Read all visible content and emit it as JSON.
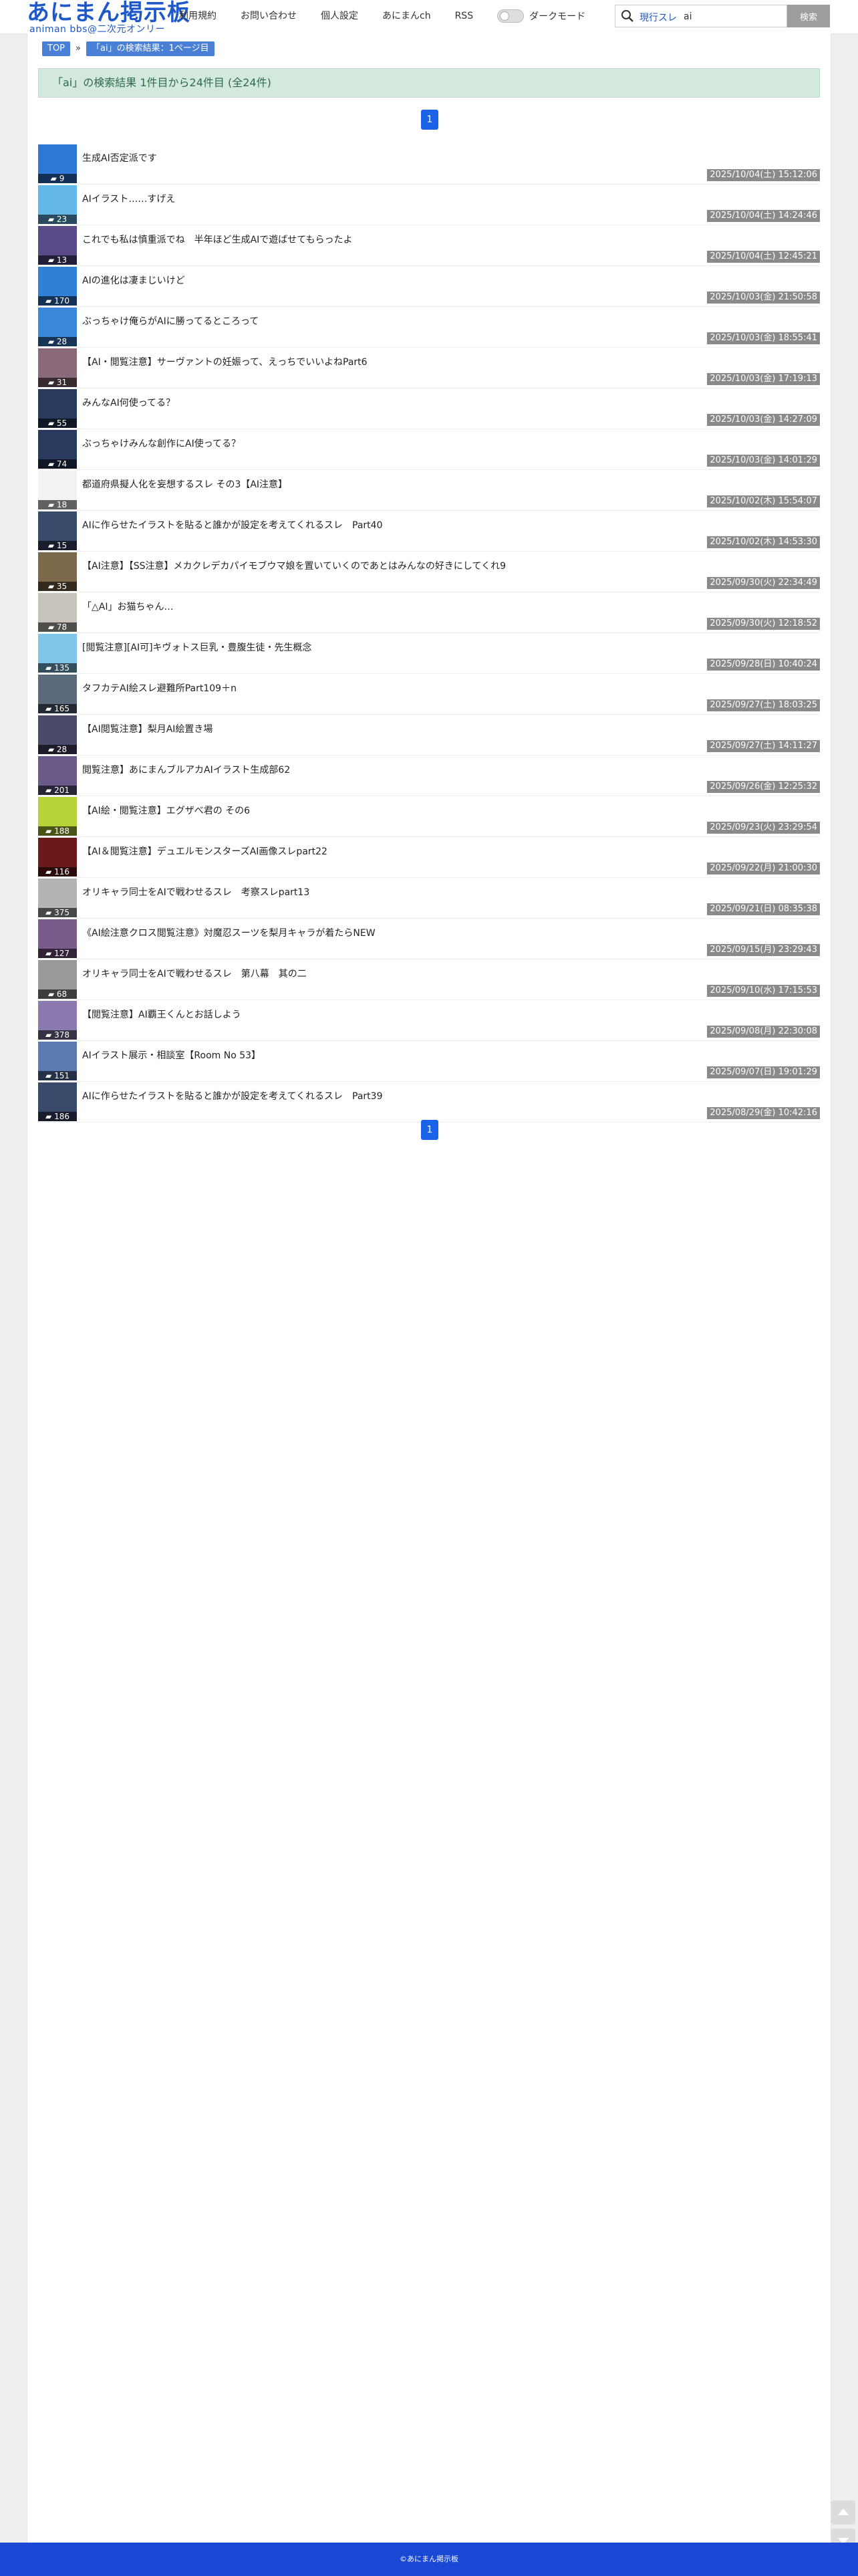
{
  "header": {
    "logo_main": "あにまん掲示板",
    "logo_sub": "animan bbs@二次元オンリー",
    "nav": [
      "利用規約",
      "お問い合わせ",
      "個人設定",
      "あにまんch",
      "RSS"
    ],
    "dark_mode_label": "ダークモード",
    "search_scope": "現行スレ",
    "search_value": "ai",
    "search_button": "検索"
  },
  "breadcrumb": [
    "TOP",
    "「ai」の検索結果：1ページ目"
  ],
  "result_banner": "「ai」の検索結果 1件目から24件目 (全24件)",
  "pager": [
    "1"
  ],
  "threads": [
    {
      "title": "生成AI否定派です",
      "count": "9",
      "date": "2025/10/04(土) 15:12:06",
      "color": "#2f78d6"
    },
    {
      "title": "AIイラスト……すげえ",
      "count": "23",
      "date": "2025/10/04(土) 14:24:46",
      "color": "#64b8ea"
    },
    {
      "title": "これでも私は慎重派でね　半年ほど生成AIで遊ばせてもらったよ",
      "count": "13",
      "date": "2025/10/04(土) 12:45:21",
      "color": "#5a4a8a"
    },
    {
      "title": "AIの進化は凄まじいけど",
      "count": "170",
      "date": "2025/10/03(金) 21:50:58",
      "color": "#3080d6"
    },
    {
      "title": "ぶっちゃけ俺らがAIに勝ってるところって",
      "count": "28",
      "date": "2025/10/03(金) 18:55:41",
      "color": "#3a86d9"
    },
    {
      "title": "【AI・閲覧注意】サーヴァントの妊娠って、えっちでいいよねPart6",
      "count": "31",
      "date": "2025/10/03(金) 17:19:13",
      "color": "#8a6a7a"
    },
    {
      "title": "みんなAI何使ってる？",
      "count": "55",
      "date": "2025/10/03(金) 14:27:09",
      "color": "#2a3a5c"
    },
    {
      "title": "ぶっちゃけみんな創作にAI使ってる？",
      "count": "74",
      "date": "2025/10/03(金) 14:01:29",
      "color": "#2a3a5c"
    },
    {
      "title": "都道府県擬人化を妄想するスレ その3【AI注意】",
      "count": "18",
      "date": "2025/10/02(木) 15:54:07",
      "color": "#f2f2f2"
    },
    {
      "title": "AIに作らせたイラストを貼ると誰かが設定を考えてくれるスレ　Part40",
      "count": "15",
      "date": "2025/10/02(木) 14:53:30",
      "color": "#3a4a6a"
    },
    {
      "title": "【AI注意】【SS注意】メカクレデカパイモブウマ娘を置いていくのであとはみんなの好きにしてくれ9",
      "count": "35",
      "date": "2025/09/30(火) 22:34:49",
      "color": "#7a6a4a"
    },
    {
      "title": "「△AI」お猫ちゃん…",
      "count": "78",
      "date": "2025/09/30(火) 12:18:52",
      "color": "#c8c4bc"
    },
    {
      "title": "[閲覧注意][AI可]キヴォトス巨乳・豊腹生徒・先生概念",
      "count": "135",
      "date": "2025/09/28(日) 10:40:24",
      "color": "#7fc6ea"
    },
    {
      "title": "タフカテAI絵スレ避難所Part109＋n",
      "count": "165",
      "date": "2025/09/27(土) 18:03:25",
      "color": "#5a6a7a"
    },
    {
      "title": "【AI閲覧注意】梨月AI絵置き場",
      "count": "28",
      "date": "2025/09/27(土) 14:11:27",
      "color": "#4a4a6a"
    },
    {
      "title": "閲覧注意】あにまんブルアカAIイラスト生成部62",
      "count": "201",
      "date": "2025/09/26(金) 12:25:32",
      "color": "#6a5a8a"
    },
    {
      "title": "【AI絵・閲覧注意】エグザべ君の その6",
      "count": "188",
      "date": "2025/09/23(火) 23:29:54",
      "color": "#b6d43a"
    },
    {
      "title": "【AI＆閲覧注意】デュエルモンスターズAI画像スレpart22",
      "count": "116",
      "date": "2025/09/22(月) 21:00:30",
      "color": "#6a1a1a"
    },
    {
      "title": "オリキャラ同士をAIで戦わせるスレ　考察スレpart13",
      "count": "375",
      "date": "2025/09/21(日) 08:35:38",
      "color": "#b4b4b4"
    },
    {
      "title": "《AI絵注意クロス閲覧注意》対魔忍スーツを梨月キャラが着たらNEW",
      "count": "127",
      "date": "2025/09/15(月) 23:29:43",
      "color": "#7a5a8a"
    },
    {
      "title": "オリキャラ同士をAIで戦わせるスレ　第八幕　其の二",
      "count": "68",
      "date": "2025/09/10(水) 17:15:53",
      "color": "#9a9a9a"
    },
    {
      "title": "【閲覧注意】AI覇王くんとお話しよう",
      "count": "378",
      "date": "2025/09/08(月) 22:30:08",
      "color": "#8a7ab0"
    },
    {
      "title": "AIイラスト展示・相談室【Room No 53】",
      "count": "151",
      "date": "2025/09/07(日) 19:01:29",
      "color": "#5a7ab0"
    },
    {
      "title": "AIに作らせたイラストを貼ると誰かが設定を考えてくれるスレ　Part39",
      "count": "186",
      "date": "2025/08/29(金) 10:42:16",
      "color": "#3a4a6a"
    }
  ],
  "footer": "©あにまん掲示板"
}
